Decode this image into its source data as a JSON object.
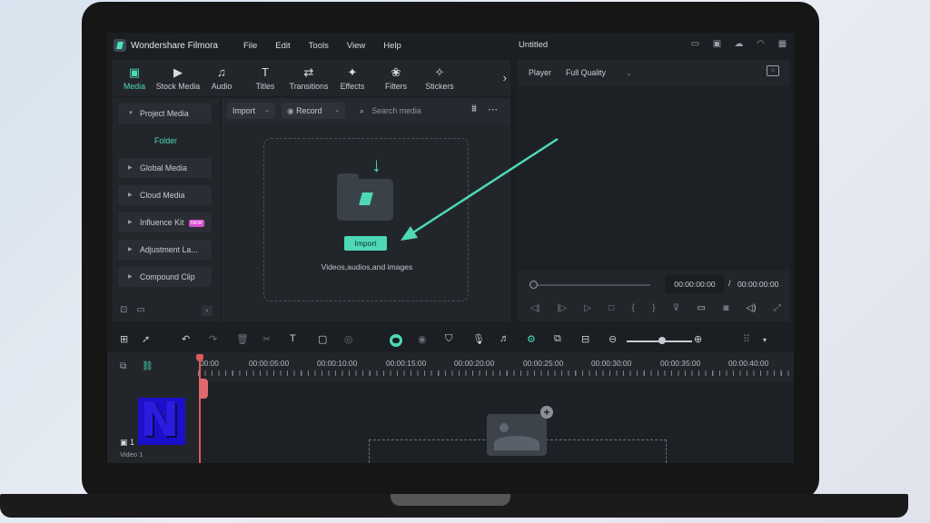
{
  "app": {
    "name": "Wondershare Filmora",
    "document_title": "Untitled",
    "menu": [
      "File",
      "Edit",
      "Tools",
      "View",
      "Help"
    ]
  },
  "media_tabs": [
    {
      "label": "Media",
      "icon": "media-icon",
      "active": true
    },
    {
      "label": "Stock Media",
      "icon": "stock-media-icon"
    },
    {
      "label": "Audio",
      "icon": "music-note-icon"
    },
    {
      "label": "Titles",
      "icon": "text-t-icon"
    },
    {
      "label": "Transitions",
      "icon": "transitions-icon"
    },
    {
      "label": "Effects",
      "icon": "sparkle-icon"
    },
    {
      "label": "Filters",
      "icon": "filters-icon"
    },
    {
      "label": "Stickers",
      "icon": "sticker-icon"
    }
  ],
  "sidebar": {
    "project_media": "Project Media",
    "folder": "Folder",
    "items": [
      {
        "label": "Global Media"
      },
      {
        "label": "Cloud Media"
      },
      {
        "label": "Influence Kit",
        "badge": "NEW"
      },
      {
        "label": "Adjustment La..."
      },
      {
        "label": "Compound Clip"
      }
    ]
  },
  "media_toolbar": {
    "import_label": "Import",
    "record_label": "Record",
    "search_placeholder": "Search media"
  },
  "dropzone": {
    "button_label": "Import",
    "hint": "Videos,audios,and images"
  },
  "player": {
    "label": "Player",
    "quality": "Full Quality",
    "current_time": "00:00:00:00",
    "separator": "/",
    "total_time": "00:00:00:00"
  },
  "timeline": {
    "ruler_labels": [
      "00:00",
      "00:00:05:00",
      "00:00:10:00",
      "00:00:15:00",
      "00:00:20:00",
      "00:00:25:00",
      "00:00:30:00",
      "00:00:35:00",
      "00:00:40:00"
    ],
    "track_name": "Video 1",
    "track_number": "1"
  },
  "colors": {
    "accent": "#4ed9b6",
    "playhead": "#e05a5a",
    "annotation_arrow": "#4ed9b6"
  }
}
